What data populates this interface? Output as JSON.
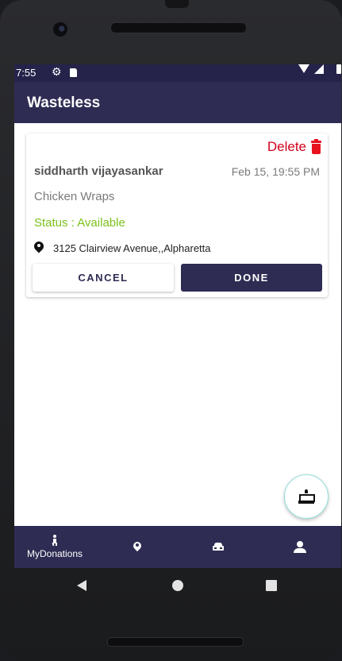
{
  "status_bar": {
    "time": "7:55"
  },
  "app_bar": {
    "title": "Wasteless"
  },
  "donation_card": {
    "delete_label": "Delete",
    "donor_name": "siddharth vijayasankar",
    "date": "Feb 15, 19:55 PM",
    "food_item": "Chicken Wraps",
    "status": "Status : Available",
    "address": "3125 Clairview Avenue,,Alpharetta",
    "cancel_label": "CANCEL",
    "done_label": "DONE"
  },
  "fab": {
    "icon": "cake-icon"
  },
  "bottom_nav": {
    "items": [
      {
        "label": "MyDonations",
        "icon": "person-icon",
        "active": true
      },
      {
        "label": "",
        "icon": "map-pin-icon"
      },
      {
        "label": "",
        "icon": "car-icon"
      },
      {
        "label": "",
        "icon": "user-icon"
      }
    ]
  },
  "colors": {
    "primary": "#2e2c53",
    "status_bar": "#25234a",
    "delete": "#d0021b",
    "status_available": "#7cc21b"
  }
}
